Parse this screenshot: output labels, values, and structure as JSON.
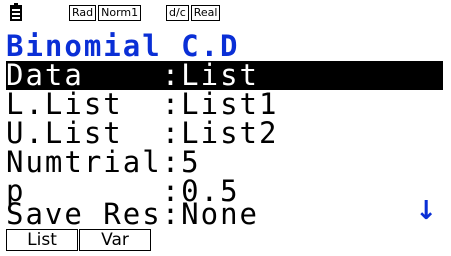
{
  "status": {
    "angle": "Rad",
    "display": "Norm1",
    "fraction": "d/c",
    "complex": "Real"
  },
  "title": "Binomial C.D",
  "rows": [
    {
      "label": "Data",
      "sep": ":",
      "value": "List"
    },
    {
      "label": "L.List",
      "sep": ":",
      "value": "List1"
    },
    {
      "label": "U.List",
      "sep": ":",
      "value": "List2"
    },
    {
      "label": "Numtrial",
      "sep": ":",
      "value": "5"
    },
    {
      "label": "p",
      "sep": ":",
      "value": "0.5"
    },
    {
      "label": "Save Res",
      "sep": ":",
      "value": "None"
    }
  ],
  "scroll_indicator": "↓",
  "function_keys": [
    "List",
    "Var"
  ],
  "colors": {
    "title": "#0a2fd6",
    "highlight_bg": "#000000",
    "highlight_fg": "#ffffff"
  }
}
